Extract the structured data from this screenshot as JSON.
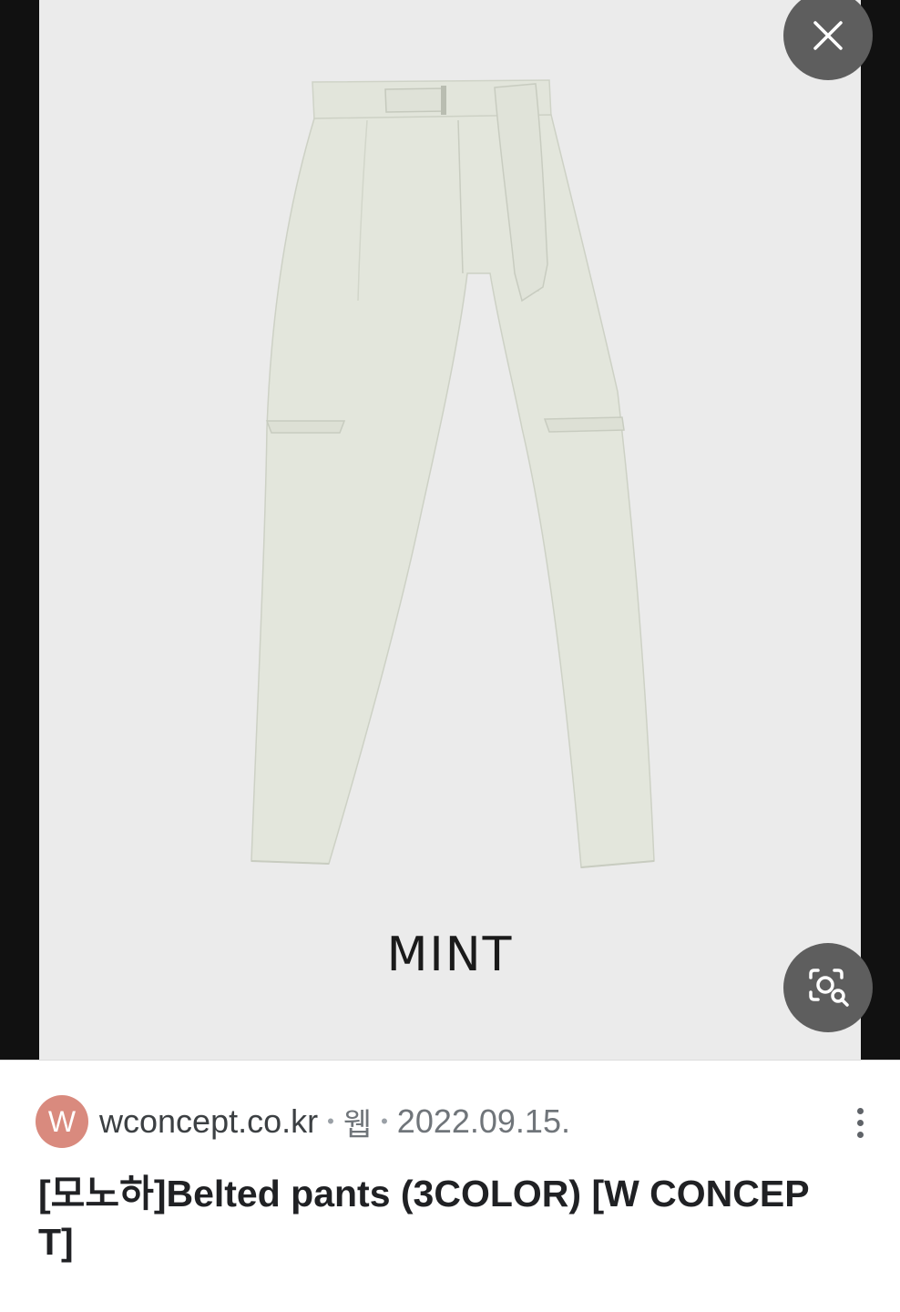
{
  "image_viewer": {
    "color_label": "MINT",
    "close_icon": "close-icon",
    "lens_icon": "lens-search-icon"
  },
  "result": {
    "favicon_letter": "W",
    "domain": "wconcept.co.kr",
    "separator": "•",
    "type": "웹",
    "date": "2022.09.15.",
    "title": "[모노하]Belted pants (3COLOR) [W CONCEPT]",
    "more_icon": "more-vert-icon"
  },
  "colors": {
    "viewer_bg": "#111111",
    "image_bg": "#ebebeb",
    "pants": "#e3e6dc",
    "button_bg": "#5e5e5e",
    "favicon_bg": "#d98a7e"
  }
}
